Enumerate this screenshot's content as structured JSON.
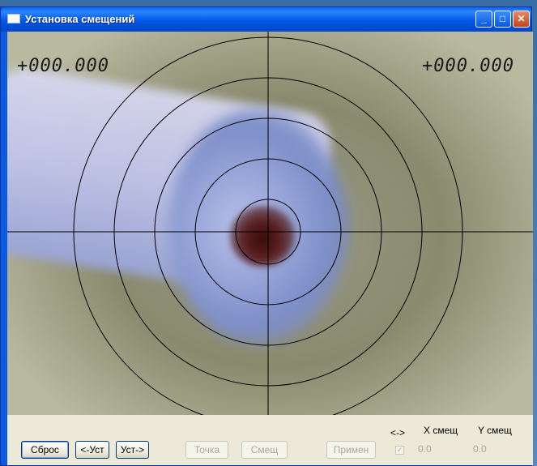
{
  "window": {
    "title": "Установка смещений",
    "minimize_glyph": "_",
    "maximize_glyph": "□",
    "close_glyph": "✕"
  },
  "video": {
    "readout_left": "+000.000",
    "readout_right": "+000.000"
  },
  "toolbar": {
    "reset_label": "Сброс",
    "left_set_label": "<-Уст",
    "right_set_label": "Уст->",
    "point_label": "Точка",
    "offset_label": "Смещ",
    "apply_label": "Примен",
    "swap_header": "<->",
    "x_offset_header": "X смещ",
    "y_offset_header": "Y смещ",
    "swap_checked": true,
    "x_offset_value": "0.0",
    "y_offset_value": "0.0"
  },
  "colors": {
    "titlebar_blue": "#0058e6",
    "close_red": "#c6401c",
    "face": "#ece9d8"
  }
}
